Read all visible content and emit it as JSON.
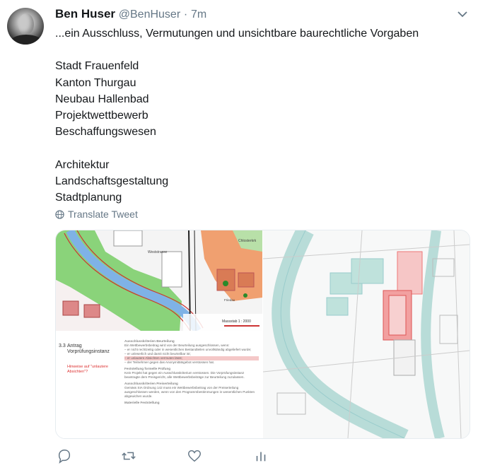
{
  "author": {
    "name": "Ben Huser",
    "handle": "@BenHuser",
    "separator": "·",
    "time": "7m"
  },
  "tweet_lines": [
    "...ein Ausschluss, Vermutungen und unsichtbare baurechtliche Vorgaben",
    "",
    "Stadt Frauenfeld",
    "Kanton Thurgau",
    "Neubau Hallenbad",
    "Projektwettbewerb",
    "Beschaffungswesen",
    "",
    "Architektur",
    "Landschaftsgestaltung",
    "Stadtplanung"
  ],
  "translate_label": "Translate Tweet",
  "map_labels": {
    "street": "Weststrasse",
    "area": "Chlosterkrk",
    "scale": "Massstab 1 : 2000",
    "place": "Friedau"
  },
  "doc": {
    "section_number": "3.3",
    "section_title": "Antrag Vorprüfungsinstanz",
    "red_note": "Hinweise auf \"unlautere Absichten\"?",
    "heading1": "Ausschlusskriterien Beurteilung",
    "intro": "Ein Wettbewerbsbeitrag wird von der Beurteilung ausgeschlossen, wenn:",
    "bullets": [
      "er nicht rechtzeitig oder in wesentlichen Bestandteilen unvollständig abgeliefert wurde;",
      "er unleserlich und damit nicht beurteilbar ist;",
      "er unlautere Absichten vermuten lässt;",
      "der Teilnehmer gegen das Anonymitätsgebot verstossen hat."
    ],
    "heading2": "Feststellung formelle Prüfung",
    "para2": "Kein Projekt hat gegen ein Ausschlusskriterium verstossen. Die Vorprüfungsinstanz beantragte dem Preisgericht, alle Wettbewerbsbeiträge zur Beurteilung zuzulassen.",
    "heading3": "Ausschlusskriterien Preiserteilung",
    "para3": "Gemäss SIA Ordnung 142 muss ein Wettbewerbsbeitrag von der Preiserteilung ausgeschlossen werden, wenn von den Programmbestimmungen in wesentlichen Punkten abgewichen wurde.",
    "heading4": "Materielle Feststellung"
  },
  "colors": {
    "accent": "#1da1f2",
    "text": "#14171a",
    "secondary": "#657786",
    "map_green": "#8ad37a",
    "map_river": "#7fb2e6",
    "map_orange": "#f0a070",
    "plan_red": "#f2a0a0"
  }
}
